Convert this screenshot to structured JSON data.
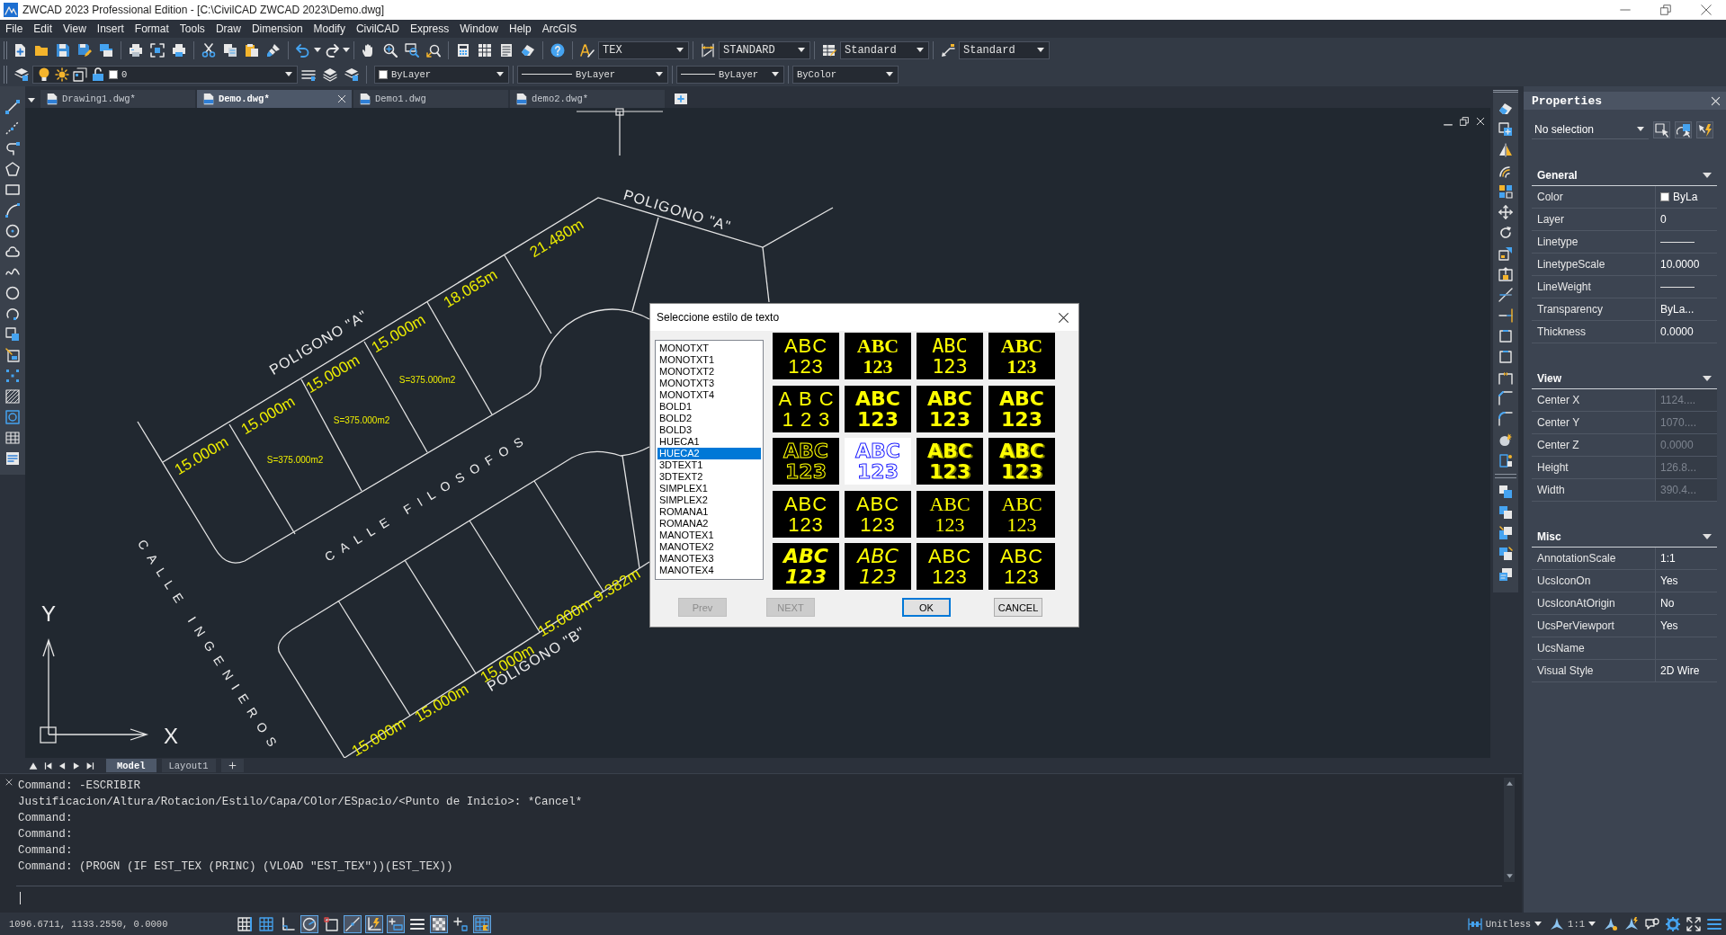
{
  "window": {
    "title": "ZWCAD 2023 Professional Edition - [C:\\CivilCAD ZWCAD 2023\\Demo.dwg]"
  },
  "menu": [
    "File",
    "Edit",
    "View",
    "Insert",
    "Format",
    "Tools",
    "Draw",
    "Dimension",
    "Modify",
    "CivilCAD",
    "Express",
    "Window",
    "Help",
    "ArcGIS"
  ],
  "toolbar": {
    "text_style": "TEX",
    "dim_style": "STANDARD",
    "table_style": "Standard",
    "multileader_style": "Standard",
    "layer": "0",
    "current_color": "ByLayer",
    "linetype": "ByLayer",
    "lineweight": "ByLayer",
    "plot_style": "ByColor"
  },
  "document_tabs": [
    {
      "label": "Drawing1.dwg*",
      "selected": false
    },
    {
      "label": "Demo.dwg*",
      "selected": true
    },
    {
      "label": "Demo1.dwg",
      "selected": false
    },
    {
      "label": "demo2.dwg*",
      "selected": false
    }
  ],
  "drawing": {
    "labels": [
      {
        "kind": "parcel",
        "text": "POLIGONO \"A\""
      },
      {
        "kind": "dimension",
        "text": "21.480m"
      },
      {
        "kind": "dimension",
        "text": "18.065m"
      },
      {
        "kind": "parcel",
        "text": "POLIGONO \"A\""
      },
      {
        "kind": "dimension",
        "text": "15.000m"
      },
      {
        "kind": "dimension",
        "text": "15.000m"
      },
      {
        "kind": "dimension",
        "text": "15.000m"
      },
      {
        "kind": "dimension",
        "text": "15.000m"
      },
      {
        "kind": "area",
        "text": "S=375.000m2"
      },
      {
        "kind": "area",
        "text": "S=375.000m2"
      },
      {
        "kind": "area",
        "text": "S=375.000m2"
      },
      {
        "kind": "street",
        "text": "CALLE FILOSOFOS"
      },
      {
        "kind": "street",
        "text": "CALLE INGENIEROS"
      },
      {
        "kind": "parcel",
        "text": "POLIGONO \"B\""
      },
      {
        "kind": "dimension",
        "text": "15.000m"
      },
      {
        "kind": "dimension",
        "text": "9.382m"
      },
      {
        "kind": "dimension",
        "text": "15.000m"
      },
      {
        "kind": "dimension",
        "text": "15.000m"
      },
      {
        "kind": "dimension",
        "text": "15.000m"
      },
      {
        "kind": "axis",
        "text": "Y"
      },
      {
        "kind": "axis",
        "text": "X"
      }
    ]
  },
  "layout_tabs": [
    {
      "label": "Model",
      "selected": true
    },
    {
      "label": "Layout1",
      "selected": false
    }
  ],
  "dialog": {
    "title": "Seleccione estilo de texto",
    "styles": [
      {
        "name": "MONOTXT",
        "kind": "thin",
        "preview": [
          "ABC",
          "123"
        ],
        "selected": false
      },
      {
        "name": "MONOTXT1",
        "kind": "double",
        "preview": [
          "ABC",
          "123"
        ],
        "selected": false
      },
      {
        "name": "MONOTXT2",
        "kind": "mono",
        "preview": [
          "ABC",
          "123"
        ],
        "selected": false
      },
      {
        "name": "MONOTXT3",
        "kind": "double",
        "preview": [
          "ABC",
          "123"
        ],
        "selected": false
      },
      {
        "name": "MONOTXT4",
        "kind": "spaced",
        "preview": [
          "ABC",
          "123"
        ],
        "selected": false
      },
      {
        "name": "BOLD1",
        "kind": "bold",
        "preview": [
          "ABC",
          "123"
        ],
        "selected": false
      },
      {
        "name": "BOLD2",
        "kind": "bold",
        "preview": [
          "ABC",
          "123"
        ],
        "selected": false
      },
      {
        "name": "BOLD3",
        "kind": "bold",
        "preview": [
          "ABC",
          "123"
        ],
        "selected": false
      },
      {
        "name": "HUECA1",
        "kind": "outline",
        "preview": [
          "ABC",
          "123"
        ],
        "selected": false
      },
      {
        "name": "HUECA2",
        "kind": "outline",
        "preview": [
          "ABC",
          "123"
        ],
        "selected": true
      },
      {
        "name": "3DTEXT1",
        "kind": "raised",
        "preview": [
          "ABC",
          "123"
        ],
        "selected": false
      },
      {
        "name": "3DTEXT2",
        "kind": "raised",
        "preview": [
          "ABC",
          "123"
        ],
        "selected": false
      },
      {
        "name": "SIMPLEX1",
        "kind": "thin",
        "preview": [
          "ABC",
          "123"
        ],
        "selected": false
      },
      {
        "name": "SIMPLEX2",
        "kind": "thin",
        "preview": [
          "ABC",
          "123"
        ],
        "selected": false
      },
      {
        "name": "ROMANA1",
        "kind": "serif",
        "preview": [
          "ABC",
          "123"
        ],
        "selected": false
      },
      {
        "name": "ROMANA2",
        "kind": "serif",
        "preview": [
          "ABC",
          "123"
        ],
        "selected": false
      },
      {
        "name": "MANOTEX1",
        "kind": "hand",
        "preview": [
          "ABC",
          "123"
        ],
        "selected": false
      },
      {
        "name": "MANOTEX2",
        "kind": "script",
        "preview": [
          "ABC",
          "123"
        ],
        "selected": false
      },
      {
        "name": "MANOTEX3",
        "kind": "thin",
        "preview": [
          "ABC",
          "123"
        ],
        "selected": false
      },
      {
        "name": "MANOTEX4",
        "kind": "thin",
        "preview": [
          "ABC",
          "123"
        ],
        "selected": false
      }
    ],
    "buttons": [
      {
        "label": "Prev",
        "disabled": true,
        "default": false
      },
      {
        "label": "NEXT",
        "disabled": true,
        "default": false
      },
      {
        "label": "OK",
        "disabled": false,
        "default": true
      },
      {
        "label": "CANCEL",
        "disabled": false,
        "default": false
      }
    ]
  },
  "properties": {
    "title": "Properties",
    "selection": "No selection",
    "sections": [
      {
        "title": "General",
        "expanded": true,
        "rows": [
          {
            "name": "Color",
            "kind": "swatch",
            "value": "ByLa",
            "disabled": false
          },
          {
            "name": "Layer",
            "kind": "text",
            "value": "0",
            "disabled": false
          },
          {
            "name": "Linetype",
            "kind": "line",
            "disabled": false
          },
          {
            "name": "LinetypeScale",
            "kind": "text",
            "value": "10.0000",
            "disabled": false
          },
          {
            "name": "LineWeight",
            "kind": "line",
            "disabled": false
          },
          {
            "name": "Transparency",
            "kind": "text",
            "value": "ByLa...",
            "disabled": false
          },
          {
            "name": "Thickness",
            "kind": "text",
            "value": "0.0000",
            "disabled": false
          }
        ]
      },
      {
        "title": "View",
        "expanded": true,
        "rows": [
          {
            "name": "Center X",
            "kind": "text",
            "value": "1124....",
            "disabled": true
          },
          {
            "name": "Center Y",
            "kind": "text",
            "value": "1070....",
            "disabled": true
          },
          {
            "name": "Center Z",
            "kind": "text",
            "value": "0.0000",
            "disabled": true
          },
          {
            "name": "Height",
            "kind": "text",
            "value": "126.8...",
            "disabled": true
          },
          {
            "name": "Width",
            "kind": "text",
            "value": "390.4...",
            "disabled": true
          }
        ]
      },
      {
        "title": "Misc",
        "expanded": true,
        "rows": [
          {
            "name": "AnnotationScale",
            "kind": "text",
            "value": "1:1",
            "disabled": false
          },
          {
            "name": "UcsIconOn",
            "kind": "text",
            "value": "Yes",
            "disabled": false
          },
          {
            "name": "UcsIconAtOrigin",
            "kind": "text",
            "value": "No",
            "disabled": false
          },
          {
            "name": "UcsPerViewport",
            "kind": "text",
            "value": "Yes",
            "disabled": false
          },
          {
            "name": "UcsName",
            "kind": "text",
            "disabled": false
          },
          {
            "name": "Visual Style",
            "kind": "text",
            "value": "2D Wire",
            "disabled": false
          }
        ]
      }
    ]
  },
  "command": {
    "lines": [
      "Command: -ESCRIBIR",
      "Justificacion/Altura/Rotacion/Estilo/Capa/COlor/ESpacio/<Punto de Inicio>: *Cancel*",
      "Command:",
      "Command:",
      "Command:",
      "Command: (PROGN (IF EST_TEX (PRINC) (VLOAD \"EST_TEX\"))(EST_TEX))"
    ]
  },
  "status_bar": {
    "coordinates": "1096.6711, 1133.2550, 0.0000",
    "toggles": [
      {
        "on": false
      },
      {
        "on": false
      },
      {
        "on": false
      },
      {
        "on": true
      },
      {
        "on": false
      },
      {
        "on": true
      },
      {
        "on": true
      },
      {
        "on": true
      },
      {
        "on": false
      },
      {
        "on": true
      },
      {
        "on": false
      },
      {
        "on": true
      }
    ],
    "units": "Unitless",
    "annotation_scale": "1:1"
  }
}
